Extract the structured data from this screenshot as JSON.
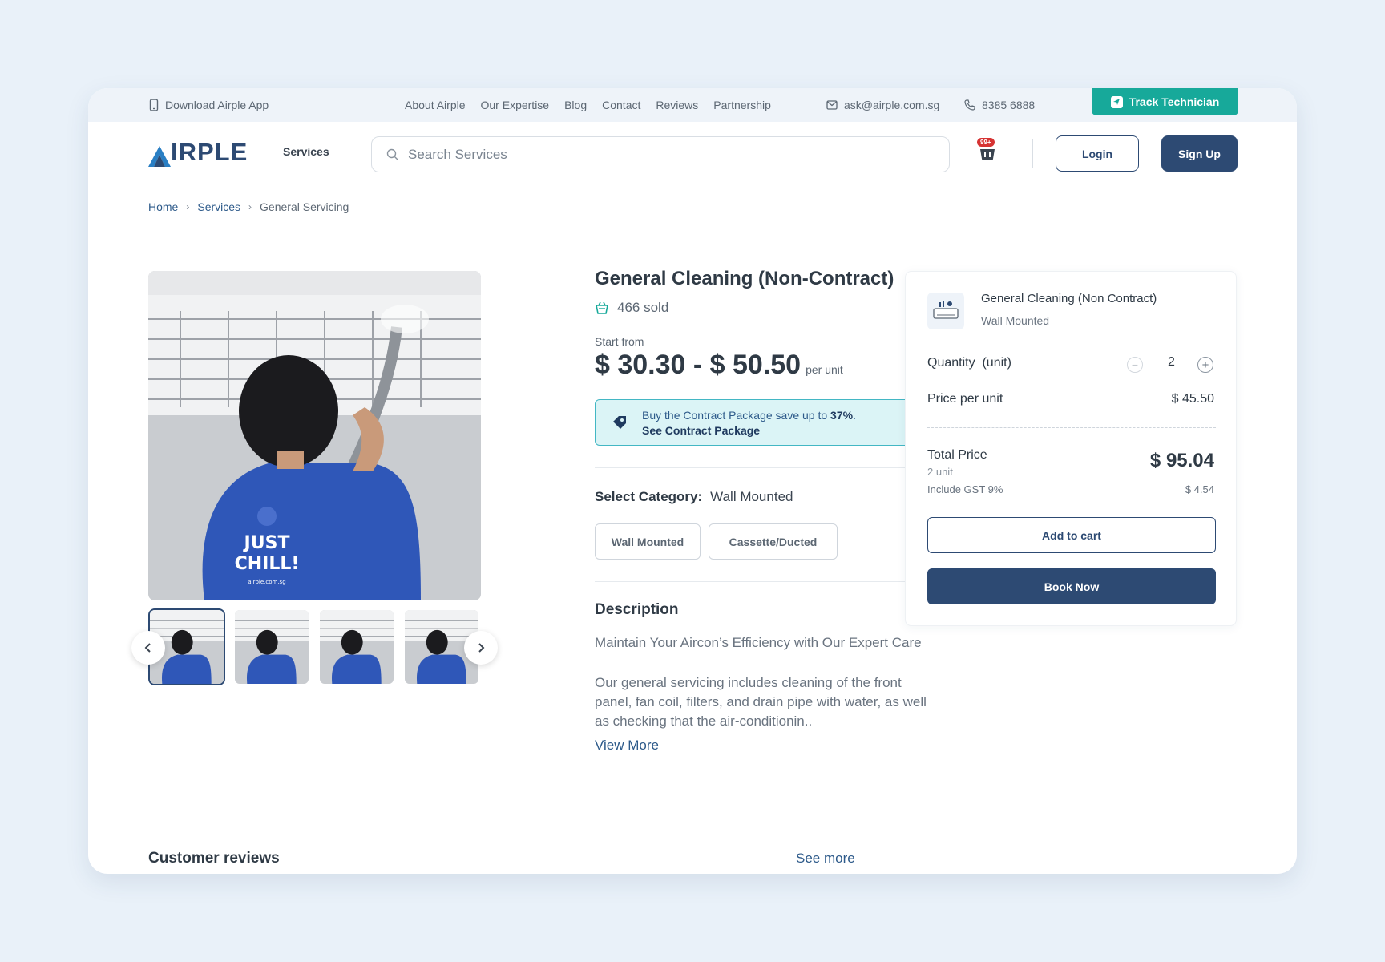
{
  "topbar": {
    "download_app": "Download Airple App",
    "links": [
      "About Airple",
      "Our Expertise",
      "Blog",
      "Contact",
      "Reviews",
      "Partnership"
    ],
    "email": "ask@airple.com.sg",
    "phone": "8385 6888",
    "track_label": "Track Technician"
  },
  "header": {
    "logo_text": "IRPLE",
    "logo_initial": "A",
    "services_label": "Services",
    "search_placeholder": "Search Services",
    "cart_badge": "99+",
    "login_label": "Login",
    "signup_label": "Sign Up"
  },
  "breadcrumb": {
    "items": [
      "Home",
      "Services",
      "General Servicing"
    ],
    "separator": "›"
  },
  "gallery": {
    "shirt_text_1": "JUST",
    "shirt_text_2": "CHILL!",
    "shirt_url": "airple.com.sg",
    "thumb_count": 4,
    "active_thumb": 0,
    "prev_icon": "chevron-left-icon",
    "next_icon": "chevron-right-icon"
  },
  "product": {
    "title": "General Cleaning (Non-Contract)",
    "sold": "466 sold",
    "start_from": "Start from",
    "price_range": "$ 30.30 - $ 50.50",
    "price_unit": "per unit",
    "promo_line1_prefix": "Buy the Contract Package save up to ",
    "promo_percent": "37%",
    "promo_line1_suffix": ".",
    "promo_link": "See Contract Package",
    "select_category_label": "Select Category:",
    "selected_category": "Wall Mounted",
    "categories": [
      "Wall Mounted",
      "Cassette/Ducted"
    ],
    "description_title": "Description",
    "description_heading": "Maintain Your Aircon’s Efficiency with Our Expert Care",
    "description_body": "Our general servicing includes cleaning of the front panel, fan coil, filters, and drain pipe with water, as well as checking that the air-conditionin..",
    "view_more": "View More"
  },
  "reviews": {
    "title": "Customer reviews",
    "see_more": "See more"
  },
  "order": {
    "item_name": "General Cleaning (Non Contract)",
    "item_variant": "Wall Mounted",
    "quantity_label": "Quantity  (unit)",
    "quantity": "2",
    "price_per_unit_label": "Price per unit",
    "price_per_unit": "$ 45.50",
    "total_label": "Total Price",
    "total_units": "2 unit",
    "gst_label": "Include GST 9%",
    "total": "$ 95.04",
    "gst_amount": "$ 4.54",
    "add_to_cart_label": "Add to cart",
    "book_now_label": "Book Now"
  },
  "colors": {
    "primary": "#2d4a73",
    "teal": "#17a99a",
    "promo_bg": "#dbf4f6",
    "badge_red": "#d63333",
    "shirt_blue": "#2f57b8"
  }
}
